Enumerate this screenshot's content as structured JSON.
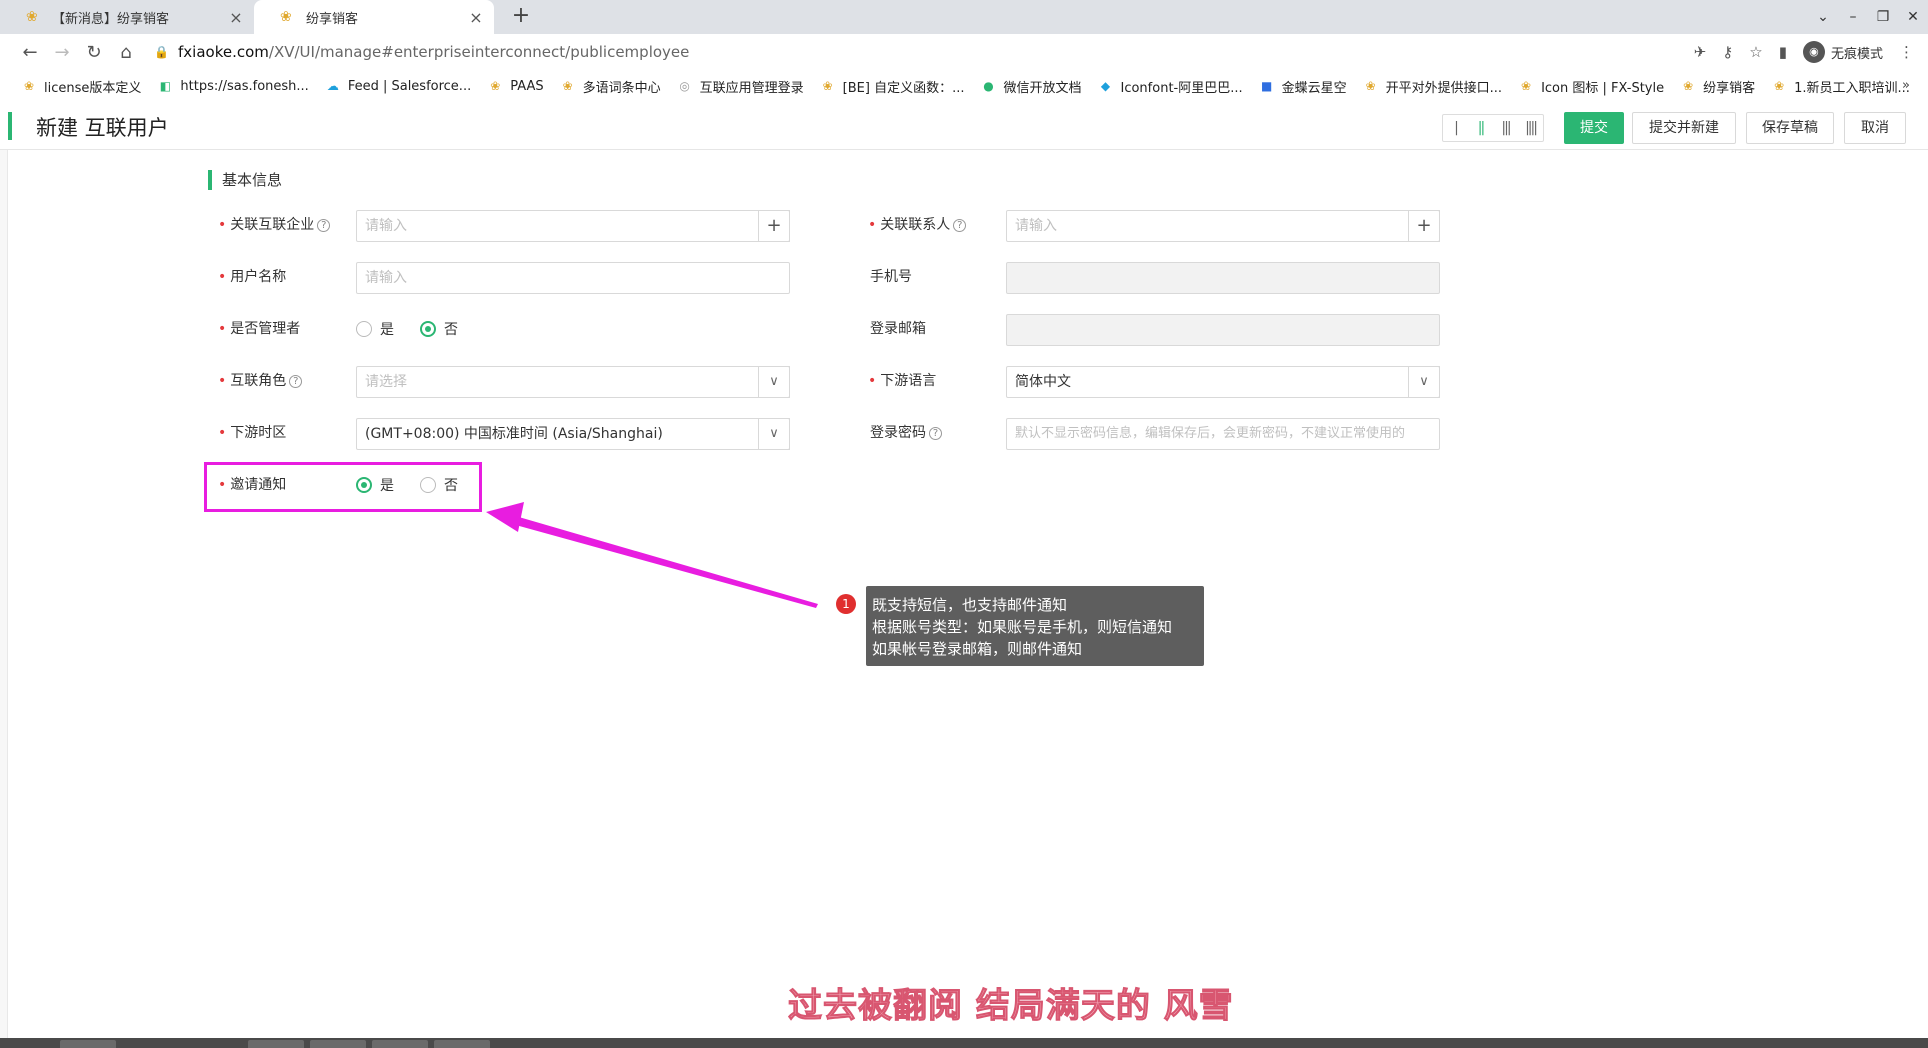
{
  "browser": {
    "tabs": [
      {
        "title": "【新消息】纷享销客",
        "active": false,
        "close": "×"
      },
      {
        "title": "纷享销客",
        "active": true,
        "close": "×"
      }
    ],
    "new_tab": "+",
    "url_host": "fxiaoke.com",
    "url_path": "/XV/UI/manage#enterpriseinterconnect/publicemployee",
    "profile_label": "无痕模式",
    "bookmarks": [
      "license版本定义",
      "https://sas.fonesh...",
      "Feed | Salesforce...",
      "PAAS",
      "多语词条中心",
      "互联应用管理登录",
      "[BE] 自定义函数：...",
      "微信开放文档",
      "Iconfont-阿里巴巴...",
      "金蝶云星空",
      "开平对外提供接口...",
      "Icon 图标 | FX-Style",
      "纷享销客",
      "1.新员工入职培训..."
    ],
    "bookmarks_more": "»"
  },
  "header": {
    "title": "新建 互联用户",
    "layout_options": [
      "|",
      "||",
      "|||",
      "||||"
    ],
    "submit": "提交",
    "submit_new": "提交并新建",
    "save_draft": "保存草稿",
    "cancel": "取消"
  },
  "form": {
    "section_title": "基本信息",
    "fields": {
      "enterprise": {
        "label": "关联互联企业",
        "required": true,
        "placeholder": "请输入",
        "addon": "+"
      },
      "contact": {
        "label": "关联联系人",
        "required": true,
        "placeholder": "请输入",
        "addon": "+"
      },
      "username": {
        "label": "用户名称",
        "required": true,
        "placeholder": "请输入"
      },
      "phone": {
        "label": "手机号",
        "required": false,
        "value": ""
      },
      "is_admin": {
        "label": "是否管理者",
        "required": true,
        "options": [
          "是",
          "否"
        ],
        "selected": "否"
      },
      "email": {
        "label": "登录邮箱",
        "required": false,
        "value": ""
      },
      "role": {
        "label": "互联角色",
        "required": true,
        "placeholder": "请选择"
      },
      "language": {
        "label": "下游语言",
        "required": true,
        "value": "简体中文"
      },
      "timezone": {
        "label": "下游时区",
        "required": true,
        "value": "(GMT+08:00) 中国标准时间 (Asia/Shanghai)"
      },
      "password": {
        "label": "登录密码",
        "required": false,
        "placeholder": "默认不显示密码信息，编辑保存后，会更新密码，不建议正常使用的"
      },
      "invite": {
        "label": "邀请通知",
        "required": true,
        "options": [
          "是",
          "否"
        ],
        "selected": "是"
      }
    }
  },
  "annotation": {
    "badge": "1",
    "lines": [
      "既支持短信，也支持邮件通知",
      "根据账号类型：如果账号是手机，则短信通知",
      "如果帐号登录邮箱，则邮件通知"
    ],
    "highlight_color": "#e81de0"
  },
  "caption": "过去被翻阅 结局满天的 风雪",
  "colors": {
    "accent": "#2bb673",
    "required": "#e4393c",
    "tooltip_bg": "#5e5e5e"
  }
}
